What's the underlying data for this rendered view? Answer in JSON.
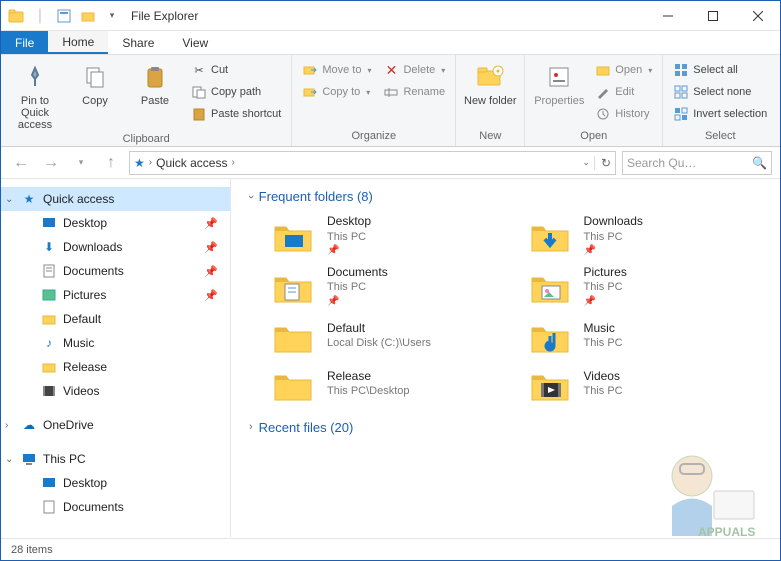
{
  "window": {
    "title": "File Explorer"
  },
  "qat": {
    "sep": "|"
  },
  "tabs": {
    "file": "File",
    "home": "Home",
    "share": "Share",
    "view": "View"
  },
  "ribbon": {
    "pin": "Pin to Quick access",
    "copy": "Copy",
    "paste": "Paste",
    "cut": "Cut",
    "copypath": "Copy path",
    "pasteshortcut": "Paste shortcut",
    "clipboard": "Clipboard",
    "moveto": "Move to",
    "copyto": "Copy to",
    "delete": "Delete",
    "rename": "Rename",
    "organize": "Organize",
    "newfolder": "New folder",
    "new": "New",
    "properties": "Properties",
    "open": "Open",
    "edit": "Edit",
    "history": "History",
    "opengrp": "Open",
    "selectall": "Select all",
    "selectnone": "Select none",
    "invert": "Invert selection",
    "select": "Select"
  },
  "nav": {
    "quickaccess": "Quick access",
    "sep": "›",
    "refresh": "↻",
    "search_placeholder": "Search Qu…"
  },
  "tree": {
    "quickaccess": "Quick access",
    "desktop": "Desktop",
    "downloads": "Downloads",
    "documents": "Documents",
    "pictures": "Pictures",
    "default": "Default",
    "music": "Music",
    "release": "Release",
    "videos": "Videos",
    "onedrive": "OneDrive",
    "thispc": "This PC",
    "desktop2": "Desktop",
    "documents2": "Documents"
  },
  "content": {
    "frequent_header": "Frequent folders (8)",
    "recent_header": "Recent files (20)",
    "items": [
      {
        "name": "Desktop",
        "loc": "This PC",
        "pinned": true,
        "icon": "desktop"
      },
      {
        "name": "Downloads",
        "loc": "This PC",
        "pinned": true,
        "icon": "downloads"
      },
      {
        "name": "Documents",
        "loc": "This PC",
        "pinned": true,
        "icon": "documents"
      },
      {
        "name": "Pictures",
        "loc": "This PC",
        "pinned": true,
        "icon": "pictures"
      },
      {
        "name": "Default",
        "loc": "Local Disk (C:)\\Users",
        "pinned": false,
        "icon": "folder"
      },
      {
        "name": "Music",
        "loc": "This PC",
        "pinned": false,
        "icon": "music"
      },
      {
        "name": "Release",
        "loc": "This PC\\Desktop",
        "pinned": false,
        "icon": "folder"
      },
      {
        "name": "Videos",
        "loc": "This PC",
        "pinned": false,
        "icon": "videos"
      }
    ]
  },
  "status": {
    "text": "28 items"
  },
  "colors": {
    "accent": "#1979ca",
    "folder": "#ffd35a",
    "folder_dark": "#e8b93e"
  }
}
